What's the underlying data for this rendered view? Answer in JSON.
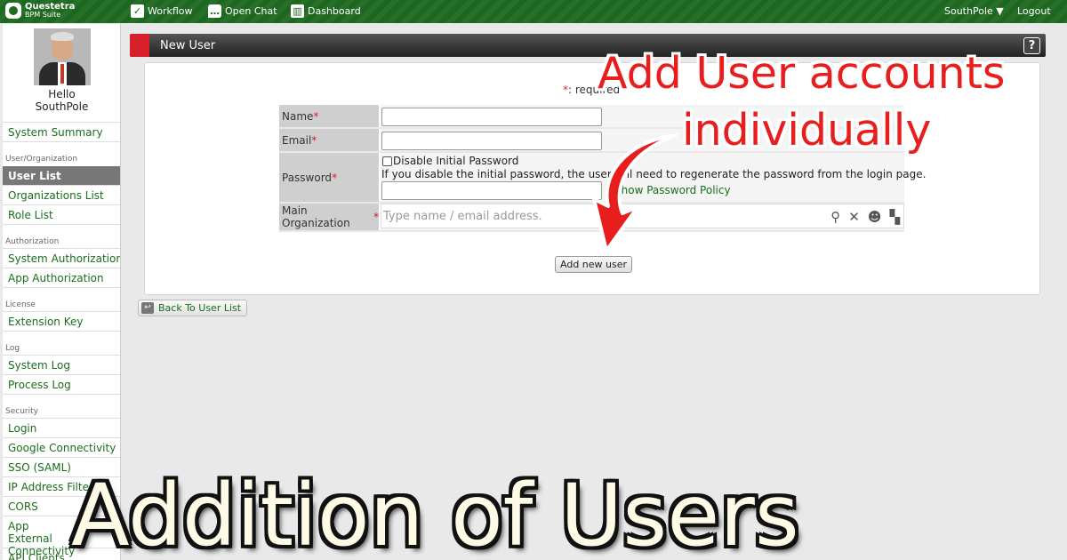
{
  "topbar": {
    "logo_line1": "Questetra",
    "logo_line2": "BPM Suite",
    "nav": [
      {
        "label": "Workflow",
        "icon": "check-icon"
      },
      {
        "label": "Open Chat",
        "icon": "chat-bubble-icon"
      },
      {
        "label": "Dashboard",
        "icon": "dashboard-icon"
      }
    ],
    "user_menu": "SouthPole ▼",
    "logout": "Logout"
  },
  "sidebar": {
    "hello": "Hello",
    "user": "SouthPole",
    "items": [
      {
        "label": "System Summary"
      },
      {
        "section": "User/Organization"
      },
      {
        "label": "User List",
        "active": true
      },
      {
        "label": "Organizations List"
      },
      {
        "label": "Role List"
      },
      {
        "section": "Authorization"
      },
      {
        "label": "System Authorization"
      },
      {
        "label": "App Authorization"
      },
      {
        "section": "License"
      },
      {
        "label": "Extension Key"
      },
      {
        "section": "Log"
      },
      {
        "label": "System Log"
      },
      {
        "label": "Process Log"
      },
      {
        "section": "Security"
      },
      {
        "label": "Login"
      },
      {
        "label": "Google Connectivity"
      },
      {
        "label": "SSO (SAML)"
      },
      {
        "label": "IP Address Filtering"
      },
      {
        "label": "CORS"
      },
      {
        "label": "App External Connectivity"
      },
      {
        "label": "API Clients"
      }
    ]
  },
  "panel": {
    "title": "New User",
    "help": "?"
  },
  "form": {
    "required_mark": "*",
    "required_note": ": required",
    "fields": {
      "name": {
        "label": "Name",
        "value": ""
      },
      "email": {
        "label": "Email",
        "value": ""
      },
      "password": {
        "label": "Password",
        "disable_label": "Disable Initial Password",
        "disable_checked": false,
        "note": "If you disable the initial password, the user will need to regenerate the password from the login page.",
        "policy_link": "Show Password Policy",
        "value": ""
      },
      "main_org": {
        "label": "Main Organization",
        "placeholder": "Type name / email address."
      }
    },
    "submit": "Add new user"
  },
  "back": "Back To User List",
  "overlay": {
    "callout_line1": "Add User accounts",
    "callout_line2": "individually",
    "title": "Addition of Users",
    "colors": {
      "callout": "#e81e1e",
      "title": "#fffae5",
      "brand": "#1f6b22"
    }
  }
}
